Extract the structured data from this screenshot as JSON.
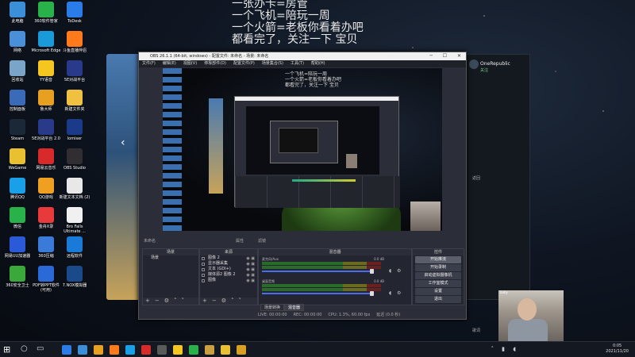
{
  "overlay_text": [
    "一张办卡=房管",
    "一个飞机=陪玩一周",
    "一个火箭=老板你看着办吧",
    "都看完了，关注一下 宝贝"
  ],
  "desktop_icons": [
    {
      "label": "此电脑",
      "color": "#3a8fd8"
    },
    {
      "label": "360软件管家",
      "color": "#2ab24a"
    },
    {
      "label": "ToDesk",
      "color": "#2a7de8"
    },
    {
      "label": "网络",
      "color": "#4a90d8"
    },
    {
      "label": "Microsoft Edge",
      "color": "#1a9ad8"
    },
    {
      "label": "斗鱼直播伴侣",
      "color": "#ff7a1a"
    },
    {
      "label": "回收站",
      "color": "#7aa4c8"
    },
    {
      "label": "YY语音",
      "color": "#f6c620"
    },
    {
      "label": "5E对战平台",
      "color": "#2a3a8a"
    },
    {
      "label": "控制面板",
      "color": "#3a6ab8"
    },
    {
      "label": "鲁大师",
      "color": "#e8a020"
    },
    {
      "label": "新建文件夹",
      "color": "#f0c040"
    },
    {
      "label": "Steam",
      "color": "#1b2838"
    },
    {
      "label": "5E对战平台 2.0",
      "color": "#2a3a8a"
    },
    {
      "label": "lomiser",
      "color": "#1a3a8a"
    },
    {
      "label": "WeGame",
      "color": "#e8c030"
    },
    {
      "label": "网易云音乐",
      "color": "#d82a2a"
    },
    {
      "label": "OBS Studio",
      "color": "#302e31"
    },
    {
      "label": "腾讯QQ",
      "color": "#1aa0e8"
    },
    {
      "label": "QQ游戏",
      "color": "#f0a020"
    },
    {
      "label": "新建文本文档 (2)",
      "color": "#e8e8e8"
    },
    {
      "label": "微信",
      "color": "#2ab24a"
    },
    {
      "label": "金舟X录",
      "color": "#e83a3a"
    },
    {
      "label": "Bro Falls Ultimate ...",
      "color": "#f0f0f0"
    },
    {
      "label": "网易UU加速器",
      "color": "#2a5ad8"
    },
    {
      "label": "360压缩",
      "color": "#3a7ad8"
    },
    {
      "label": "远程软件",
      "color": "#1a7ad8"
    },
    {
      "label": "360安全卫士",
      "color": "#3aa83a"
    },
    {
      "label": "PDF转PPT软件 (可用)",
      "color": "#2a6ad8"
    },
    {
      "label": "7.NOX模拟器",
      "color": "#1a4a8a"
    }
  ],
  "obs": {
    "title": "OBS 26.1.1 (64-bit, windows) - 配置文件: 未命名 - 场景: 未命名",
    "menu": [
      "文件(F)",
      "编辑(E)",
      "视图(V)",
      "停靠部件(D)",
      "配置文件(P)",
      "场景集合(S)",
      "工具(T)",
      "帮助(H)"
    ],
    "preview_text": "一个飞机=陪玩一周\n一个火箭=老板你看着办吧\n都看完了，关注一下 宝贝",
    "source_name": "未命名",
    "props_label": "属性",
    "filters_label": "滤镜",
    "docks": {
      "scenes": "场景",
      "sources": "来源",
      "mixer": "混音器",
      "controls": "控件"
    },
    "scenes": [
      "场景"
    ],
    "sources": [
      {
        "label": "图像 2"
      },
      {
        "label": "显示器采集"
      },
      {
        "label": "文本 (GDI+)"
      },
      {
        "label": "媒体源2 图像 2"
      },
      {
        "label": "图像"
      }
    ],
    "mixer": [
      {
        "name": "麦克风/Aux",
        "db": "0.0 dB"
      },
      {
        "name": "桌面音频",
        "db": "0.0 dB"
      }
    ],
    "controls": [
      "开始推流",
      "开始录制",
      "启动虚拟摄像机",
      "工作室模式",
      "设置",
      "退出"
    ],
    "tabs": [
      "场景转换",
      "混音器"
    ],
    "status": [
      "LIVE: 00:00:00",
      "REC: 00:00:00",
      "CPU: 1.3%, 60.00 fps",
      "延迟 (0.0 秒)"
    ]
  },
  "music_app": {
    "name": "OneRepublic",
    "sub": "关注",
    "b1": "返回",
    "b2": "歌词",
    "b3": "下载"
  },
  "cam_tag": "baby",
  "taskbar": {
    "time": "0:05",
    "date": "2021/11/20"
  }
}
